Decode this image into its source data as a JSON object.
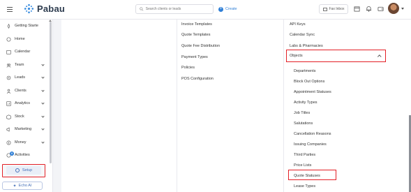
{
  "topbar": {
    "brand": "Pabau",
    "search_placeholder": "Search clients or leads",
    "create_label": "Create",
    "fax_label": "Fax Inbox"
  },
  "sidebar": {
    "items": [
      {
        "label": "Getting Starte",
        "icon": "rocket-icon"
      },
      {
        "label": "Home",
        "icon": "home-icon"
      },
      {
        "label": "Calendar",
        "icon": "calendar-icon"
      },
      {
        "label": "Team",
        "icon": "team-icon"
      },
      {
        "label": "Leads",
        "icon": "leads-icon"
      },
      {
        "label": "Clients",
        "icon": "clients-icon"
      },
      {
        "label": "Analytics",
        "icon": "analytics-icon"
      },
      {
        "label": "Stock",
        "icon": "stock-icon"
      },
      {
        "label": "Marketing",
        "icon": "marketing-icon"
      },
      {
        "label": "Money",
        "icon": "money-icon"
      },
      {
        "label": "Activities",
        "icon": "activities-icon",
        "badge": "8"
      }
    ],
    "setup_label": "Setup",
    "echo_label": "Echo AI"
  },
  "columns": {
    "middle": [
      "Invoice Templates",
      "Quote Templates",
      "Quote Fee Distribution",
      "Payment Types",
      "Policies",
      "POS Configuration"
    ],
    "right_top": [
      "API Keys",
      "Calendar Sync",
      "Labs & Pharmacies"
    ],
    "objects_label": "Objects",
    "objects_children": [
      "Departments",
      "Block Out Options",
      "Appointment Statuses",
      "Activity Types",
      "Job Titles",
      "Salutations",
      "Cancellation Reasons",
      "Issuing Companies",
      "Third Parties",
      "Price Lists",
      "Quote Statuses",
      "Lease Types"
    ]
  },
  "colors": {
    "accent": "#2f7fd6",
    "highlight": "#e31f26",
    "brand_dark": "#2c3b4e"
  }
}
